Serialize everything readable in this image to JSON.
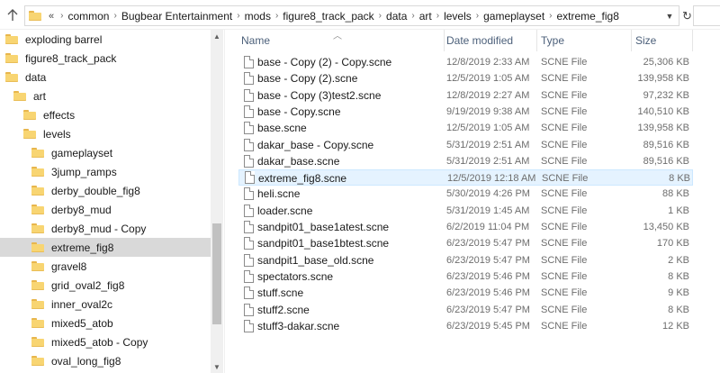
{
  "address": {
    "more": "«",
    "crumbs": [
      "common",
      "Bugbear Entertainment",
      "mods",
      "figure8_track_pack",
      "data",
      "art",
      "levels",
      "gameplayset",
      "extreme_fig8"
    ]
  },
  "nav": {
    "items": [
      {
        "label": "exploding barrel",
        "indent": 0
      },
      {
        "label": "figure8_track_pack",
        "indent": 0
      },
      {
        "label": "data",
        "indent": 1
      },
      {
        "label": "art",
        "indent": 2
      },
      {
        "label": "effects",
        "indent": 3
      },
      {
        "label": "levels",
        "indent": 3
      },
      {
        "label": "gameplayset",
        "indent": 4
      },
      {
        "label": "3jump_ramps",
        "indent": 5
      },
      {
        "label": "derby_double_fig8",
        "indent": 5
      },
      {
        "label": "derby8_mud",
        "indent": 5
      },
      {
        "label": "derby8_mud - Copy",
        "indent": 5
      },
      {
        "label": "extreme_fig8",
        "indent": 5,
        "selected": true
      },
      {
        "label": "gravel8",
        "indent": 5
      },
      {
        "label": "grid_oval2_fig8",
        "indent": 5
      },
      {
        "label": "inner_oval2c",
        "indent": 5
      },
      {
        "label": "mixed5_atob",
        "indent": 5
      },
      {
        "label": "mixed5_atob - Copy",
        "indent": 5
      },
      {
        "label": "oval_long_fig8",
        "indent": 5
      }
    ]
  },
  "columns": {
    "name": "Name",
    "date": "Date modified",
    "type": "Type",
    "size": "Size"
  },
  "files": [
    {
      "name": "base - Copy (2) - Copy.scne",
      "date": "12/8/2019 2:33 AM",
      "type": "SCNE File",
      "size": "25,306 KB"
    },
    {
      "name": "base - Copy (2).scne",
      "date": "12/5/2019 1:05 AM",
      "type": "SCNE File",
      "size": "139,958 KB"
    },
    {
      "name": "base - Copy (3)test2.scne",
      "date": "12/8/2019 2:27 AM",
      "type": "SCNE File",
      "size": "97,232 KB"
    },
    {
      "name": "base - Copy.scne",
      "date": "9/19/2019 9:38 AM",
      "type": "SCNE File",
      "size": "140,510 KB"
    },
    {
      "name": "base.scne",
      "date": "12/5/2019 1:05 AM",
      "type": "SCNE File",
      "size": "139,958 KB"
    },
    {
      "name": "dakar_base - Copy.scne",
      "date": "5/31/2019 2:51 AM",
      "type": "SCNE File",
      "size": "89,516 KB"
    },
    {
      "name": "dakar_base.scne",
      "date": "5/31/2019 2:51 AM",
      "type": "SCNE File",
      "size": "89,516 KB"
    },
    {
      "name": "extreme_fig8.scne",
      "date": "12/5/2019 12:18 AM",
      "type": "SCNE File",
      "size": "8 KB",
      "highlight": true
    },
    {
      "name": "heli.scne",
      "date": "5/30/2019 4:26 PM",
      "type": "SCNE File",
      "size": "88 KB"
    },
    {
      "name": "loader.scne",
      "date": "5/31/2019 1:45 AM",
      "type": "SCNE File",
      "size": "1 KB"
    },
    {
      "name": "sandpit01_base1atest.scne",
      "date": "6/2/2019 11:04 PM",
      "type": "SCNE File",
      "size": "13,450 KB"
    },
    {
      "name": "sandpit01_base1btest.scne",
      "date": "6/23/2019 5:47 PM",
      "type": "SCNE File",
      "size": "170 KB"
    },
    {
      "name": "sandpit1_base_old.scne",
      "date": "6/23/2019 5:47 PM",
      "type": "SCNE File",
      "size": "2 KB"
    },
    {
      "name": "spectators.scne",
      "date": "6/23/2019 5:46 PM",
      "type": "SCNE File",
      "size": "8 KB"
    },
    {
      "name": "stuff.scne",
      "date": "6/23/2019 5:46 PM",
      "type": "SCNE File",
      "size": "9 KB"
    },
    {
      "name": "stuff2.scne",
      "date": "6/23/2019 5:47 PM",
      "type": "SCNE File",
      "size": "8 KB"
    },
    {
      "name": "stuff3-dakar.scne",
      "date": "6/23/2019 5:45 PM",
      "type": "SCNE File",
      "size": "12 KB"
    }
  ],
  "icons": {
    "up": "arrow-up-icon",
    "folder": "folder-icon",
    "file": "file-icon",
    "refresh": "refresh-icon",
    "dropdown": "chevron-down-icon"
  },
  "colors": {
    "folder": "#f8d572",
    "selected": "#d9d9d9",
    "highlight": "#e5f3ff",
    "header_text": "#4c607a"
  }
}
